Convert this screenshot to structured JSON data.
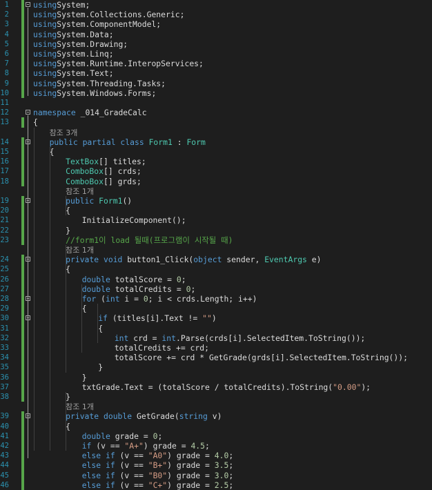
{
  "editor": {
    "lines": [
      {
        "n": "1",
        "indent": 0,
        "fold": true,
        "chg": true,
        "t": [
          [
            "kw",
            "using"
          ],
          [
            "",
            "System;"
          ]
        ]
      },
      {
        "n": "2",
        "indent": 0,
        "chg": true,
        "t": [
          [
            "kw",
            "using"
          ],
          [
            "",
            "System.Collections.Generic;"
          ]
        ]
      },
      {
        "n": "3",
        "indent": 0,
        "chg": true,
        "t": [
          [
            "kw",
            "using"
          ],
          [
            "",
            "System.ComponentModel;"
          ]
        ]
      },
      {
        "n": "4",
        "indent": 0,
        "chg": true,
        "t": [
          [
            "kw",
            "using"
          ],
          [
            "",
            "System.Data;"
          ]
        ]
      },
      {
        "n": "5",
        "indent": 0,
        "chg": true,
        "t": [
          [
            "kw",
            "using"
          ],
          [
            "",
            "System.Drawing;"
          ]
        ]
      },
      {
        "n": "6",
        "indent": 0,
        "chg": true,
        "t": [
          [
            "kw",
            "using"
          ],
          [
            "",
            "System.Linq;"
          ]
        ]
      },
      {
        "n": "7",
        "indent": 0,
        "chg": true,
        "t": [
          [
            "kw",
            "using"
          ],
          [
            "",
            "System.Runtime.InteropServices;"
          ]
        ]
      },
      {
        "n": "8",
        "indent": 0,
        "chg": true,
        "t": [
          [
            "kw",
            "using"
          ],
          [
            "",
            "System.Text;"
          ]
        ]
      },
      {
        "n": "9",
        "indent": 0,
        "chg": true,
        "t": [
          [
            "kw",
            "using"
          ],
          [
            "",
            "System.Threading.Tasks;"
          ]
        ]
      },
      {
        "n": "10",
        "indent": 0,
        "chg": true,
        "t": [
          [
            "kw",
            "using"
          ],
          [
            "",
            "System.Windows.Forms;"
          ]
        ]
      },
      {
        "n": "11",
        "indent": 0,
        "t": []
      },
      {
        "n": "12",
        "indent": 0,
        "fold": true,
        "t": [
          [
            "kw",
            "namespace"
          ],
          [
            "",
            " _014_GradeCalc"
          ]
        ]
      },
      {
        "n": "13",
        "indent": 0,
        "chg": true,
        "t": [
          [
            "",
            "{"
          ]
        ]
      },
      {
        "n": "",
        "indent": 2,
        "ref": true,
        "t": [
          [
            "ref",
            "참조 3개"
          ]
        ]
      },
      {
        "n": "14",
        "indent": 2,
        "fold": true,
        "chg": true,
        "t": [
          [
            "kw",
            "public partial class"
          ],
          [
            "",
            " "
          ],
          [
            "ty",
            "Form1"
          ],
          [
            "",
            " : "
          ],
          [
            "ty",
            "Form"
          ]
        ]
      },
      {
        "n": "15",
        "indent": 2,
        "chg": true,
        "t": [
          [
            "",
            "{"
          ]
        ]
      },
      {
        "n": "16",
        "indent": 4,
        "chg": true,
        "t": [
          [
            "ty",
            "TextBox"
          ],
          [
            "",
            "[] titles;"
          ]
        ]
      },
      {
        "n": "17",
        "indent": 4,
        "chg": true,
        "t": [
          [
            "ty",
            "ComboBox"
          ],
          [
            "",
            "[] crds;"
          ]
        ]
      },
      {
        "n": "18",
        "indent": 4,
        "chg": true,
        "t": [
          [
            "ty",
            "ComboBox"
          ],
          [
            "",
            "[] grds;"
          ]
        ]
      },
      {
        "n": "",
        "indent": 4,
        "ref": true,
        "t": [
          [
            "ref",
            "참조 1개"
          ]
        ]
      },
      {
        "n": "19",
        "indent": 4,
        "fold": true,
        "chg": true,
        "t": [
          [
            "kw",
            "public"
          ],
          [
            "",
            " "
          ],
          [
            "ty",
            "Form1"
          ],
          [
            "",
            "()"
          ]
        ]
      },
      {
        "n": "20",
        "indent": 4,
        "chg": true,
        "t": [
          [
            "",
            "{"
          ]
        ]
      },
      {
        "n": "21",
        "indent": 6,
        "chg": true,
        "t": [
          [
            "",
            "InitializeComponent();"
          ]
        ]
      },
      {
        "n": "22",
        "indent": 4,
        "chg": true,
        "t": [
          [
            "",
            "}"
          ]
        ]
      },
      {
        "n": "23",
        "indent": 4,
        "chg": true,
        "t": [
          [
            "cm",
            "//form1이 load 될때(프로그램이 시작될 때)"
          ]
        ]
      },
      {
        "n": "",
        "indent": 4,
        "ref": true,
        "t": [
          [
            "ref",
            "참조 1개"
          ]
        ]
      },
      {
        "n": "24",
        "indent": 4,
        "fold": true,
        "chg": true,
        "t": [
          [
            "kw",
            "private void"
          ],
          [
            "",
            " button1_Click("
          ],
          [
            "kw",
            "object"
          ],
          [
            "",
            " sender, "
          ],
          [
            "ty",
            "EventArgs"
          ],
          [
            "",
            " e)"
          ]
        ]
      },
      {
        "n": "25",
        "indent": 4,
        "chg": true,
        "t": [
          [
            "",
            "{"
          ]
        ]
      },
      {
        "n": "26",
        "indent": 6,
        "chg": true,
        "t": [
          [
            "kw",
            "double"
          ],
          [
            "",
            " totalScore = "
          ],
          [
            "nu",
            "0"
          ],
          [
            "",
            ";"
          ]
        ]
      },
      {
        "n": "27",
        "indent": 6,
        "chg": true,
        "t": [
          [
            "kw",
            "double"
          ],
          [
            "",
            " totalCredits = "
          ],
          [
            "nu",
            "0"
          ],
          [
            "",
            ";"
          ]
        ]
      },
      {
        "n": "28",
        "indent": 6,
        "fold": true,
        "chg": true,
        "t": [
          [
            "kw",
            "for"
          ],
          [
            "",
            " ("
          ],
          [
            "kw",
            "int"
          ],
          [
            "",
            " i = "
          ],
          [
            "nu",
            "0"
          ],
          [
            "",
            "; i < crds.Length; i++)"
          ]
        ]
      },
      {
        "n": "29",
        "indent": 6,
        "chg": true,
        "t": [
          [
            "",
            "{"
          ]
        ]
      },
      {
        "n": "30",
        "indent": 8,
        "fold": true,
        "chg": true,
        "t": [
          [
            "kw",
            "if"
          ],
          [
            "",
            " (titles[i].Text != "
          ],
          [
            "st",
            "\"\""
          ],
          [
            "",
            ")"
          ]
        ]
      },
      {
        "n": "31",
        "indent": 8,
        "chg": true,
        "t": [
          [
            "",
            "{"
          ]
        ]
      },
      {
        "n": "32",
        "indent": 10,
        "chg": true,
        "t": [
          [
            "kw",
            "int"
          ],
          [
            "",
            " crd = "
          ],
          [
            "kw",
            "int"
          ],
          [
            "",
            ".Parse(crds[i].SelectedItem.ToString());"
          ]
        ]
      },
      {
        "n": "33",
        "indent": 10,
        "chg": true,
        "t": [
          [
            "",
            "totalCredits += crd;"
          ]
        ]
      },
      {
        "n": "34",
        "indent": 10,
        "chg": true,
        "t": [
          [
            "",
            "totalScore += crd * GetGrade(grds[i].SelectedItem.ToString());"
          ]
        ]
      },
      {
        "n": "35",
        "indent": 8,
        "chg": true,
        "t": [
          [
            "",
            "}"
          ]
        ]
      },
      {
        "n": "36",
        "indent": 6,
        "chg": true,
        "t": [
          [
            "",
            "}"
          ]
        ]
      },
      {
        "n": "37",
        "indent": 6,
        "chg": true,
        "t": [
          [
            "",
            "txtGrade.Text = (totalScore / totalCredits).ToString("
          ],
          [
            "st",
            "\"0.00\""
          ],
          [
            "",
            ");"
          ]
        ]
      },
      {
        "n": "38",
        "indent": 4,
        "chg": true,
        "t": [
          [
            "",
            "}"
          ]
        ]
      },
      {
        "n": "",
        "indent": 4,
        "ref": true,
        "t": [
          [
            "ref",
            "참조 1개"
          ]
        ]
      },
      {
        "n": "39",
        "indent": 4,
        "fold": true,
        "chg": true,
        "t": [
          [
            "kw",
            "private double"
          ],
          [
            "",
            " GetGrade("
          ],
          [
            "kw",
            "string"
          ],
          [
            "",
            " v)"
          ]
        ]
      },
      {
        "n": "40",
        "indent": 4,
        "chg": true,
        "t": [
          [
            "",
            "{"
          ]
        ]
      },
      {
        "n": "41",
        "indent": 6,
        "chg": true,
        "t": [
          [
            "kw",
            "double"
          ],
          [
            "",
            " grade = "
          ],
          [
            "nu",
            "0"
          ],
          [
            "",
            ";"
          ]
        ]
      },
      {
        "n": "42",
        "indent": 6,
        "chg": true,
        "t": [
          [
            "kw",
            "if"
          ],
          [
            "",
            " (v == "
          ],
          [
            "st",
            "\"A+\""
          ],
          [
            "",
            ") grade = "
          ],
          [
            "nu",
            "4.5"
          ],
          [
            "",
            ";"
          ]
        ]
      },
      {
        "n": "43",
        "indent": 6,
        "chg": true,
        "t": [
          [
            "kw",
            "else if"
          ],
          [
            "",
            " (v == "
          ],
          [
            "st",
            "\"A0\""
          ],
          [
            "",
            ") grade = "
          ],
          [
            "nu",
            "4.0"
          ],
          [
            "",
            ";"
          ]
        ]
      },
      {
        "n": "44",
        "indent": 6,
        "chg": true,
        "t": [
          [
            "kw",
            "else if"
          ],
          [
            "",
            " (v == "
          ],
          [
            "st",
            "\"B+\""
          ],
          [
            "",
            ") grade = "
          ],
          [
            "nu",
            "3.5"
          ],
          [
            "",
            ";"
          ]
        ]
      },
      {
        "n": "45",
        "indent": 6,
        "chg": true,
        "t": [
          [
            "kw",
            "else if"
          ],
          [
            "",
            " (v == "
          ],
          [
            "st",
            "\"B0\""
          ],
          [
            "",
            ") grade = "
          ],
          [
            "nu",
            "3.0"
          ],
          [
            "",
            ";"
          ]
        ]
      },
      {
        "n": "46",
        "indent": 6,
        "chg": true,
        "t": [
          [
            "kw",
            "else if"
          ],
          [
            "",
            " (v == "
          ],
          [
            "st",
            "\"C+\""
          ],
          [
            "",
            ") grade = "
          ],
          [
            "nu",
            "2.5"
          ],
          [
            "",
            ";"
          ]
        ]
      }
    ]
  }
}
